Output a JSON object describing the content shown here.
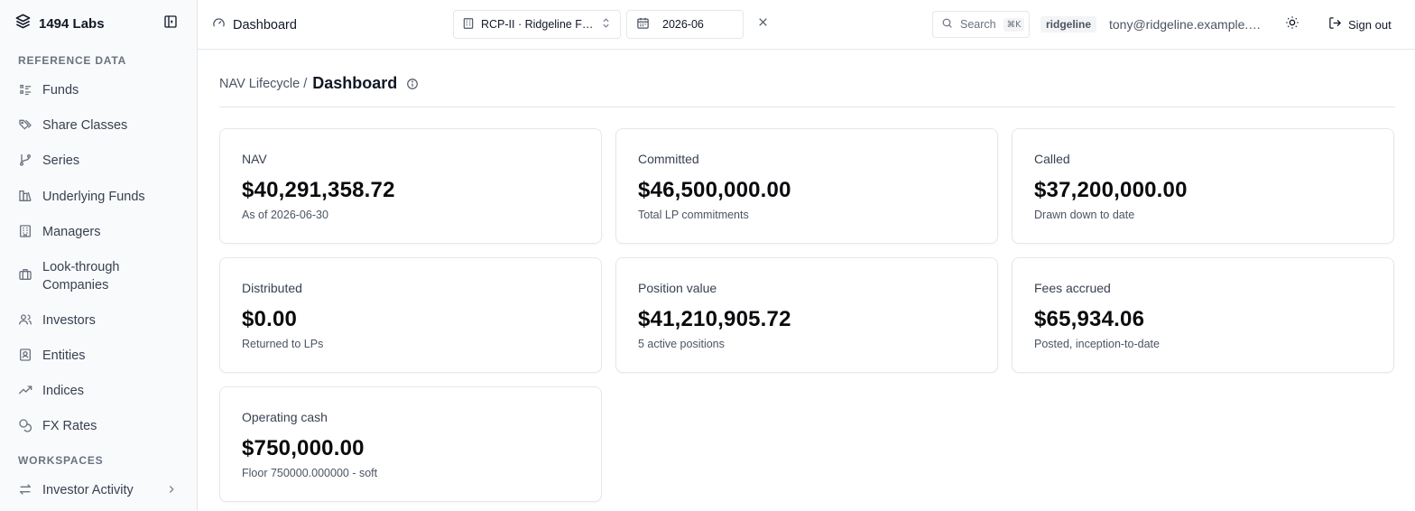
{
  "brand": {
    "name": "1494 Labs"
  },
  "sidebar": {
    "reference_section": "REFERENCE DATA",
    "workspaces_section": "WORKSPACES",
    "items": [
      {
        "label": "Funds",
        "icon": "list-icon"
      },
      {
        "label": "Share Classes",
        "icon": "tags-icon"
      },
      {
        "label": "Series",
        "icon": "git-branch-icon"
      },
      {
        "label": "Underlying Funds",
        "icon": "library-icon"
      },
      {
        "label": "Managers",
        "icon": "building-icon"
      },
      {
        "label": "Look-through Companies",
        "icon": "briefcase-icon"
      },
      {
        "label": "Investors",
        "icon": "users-icon"
      },
      {
        "label": "Entities",
        "icon": "contact-icon"
      },
      {
        "label": "Indices",
        "icon": "trending-up-icon"
      },
      {
        "label": "FX Rates",
        "icon": "coins-icon"
      }
    ],
    "workspaces": [
      {
        "label": "Investor Activity",
        "icon": "arrows-left-right-icon"
      }
    ]
  },
  "topbar": {
    "title": "Dashboard",
    "fund_select": "RCP-II · Ridgeline Fund II",
    "period": "2026-06",
    "search_placeholder": "Search",
    "search_shortcut": "⌘K",
    "tenant": "ridgeline",
    "user_email": "tony@ridgeline.example.com",
    "signout_label": "Sign out"
  },
  "page": {
    "breadcrumb_parent": "NAV Lifecycle /",
    "title": "Dashboard"
  },
  "cards": [
    {
      "label": "NAV",
      "value": "$40,291,358.72",
      "sub": "As of 2026-06-30"
    },
    {
      "label": "Committed",
      "value": "$46,500,000.00",
      "sub": "Total LP commitments"
    },
    {
      "label": "Called",
      "value": "$37,200,000.00",
      "sub": "Drawn down to date"
    },
    {
      "label": "Distributed",
      "value": "$0.00",
      "sub": "Returned to LPs"
    },
    {
      "label": "Position value",
      "value": "$41,210,905.72",
      "sub": "5 active positions"
    },
    {
      "label": "Fees accrued",
      "value": "$65,934.06",
      "sub": "Posted, inception-to-date"
    },
    {
      "label": "Operating cash",
      "value": "$750,000.00",
      "sub": "Floor 750000.000000 - soft"
    }
  ]
}
